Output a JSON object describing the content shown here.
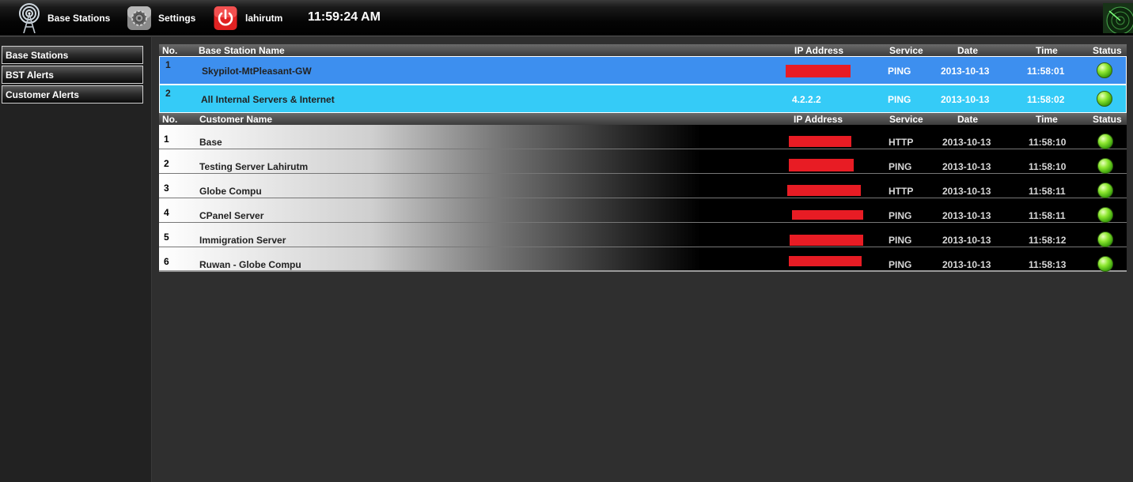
{
  "topbar": {
    "items": [
      {
        "label": "Base Stations",
        "icon": "antenna-icon"
      },
      {
        "label": "Settings",
        "icon": "gear-icon"
      },
      {
        "label": "lahirutm",
        "icon": "power-icon"
      }
    ],
    "clock": "11:59:24 AM",
    "radar_icon": "radar-icon"
  },
  "sidebar": {
    "items": [
      {
        "label": "Base Stations"
      },
      {
        "label": "BST Alerts"
      },
      {
        "label": "Customer Alerts"
      }
    ]
  },
  "base_stations": {
    "headers": {
      "no": "No.",
      "name": "Base Station Name",
      "ip": "IP Address",
      "service": "Service",
      "date": "Date",
      "time": "Time",
      "status": "Status"
    },
    "rows": [
      {
        "no": "1",
        "name": "Skypilot-MtPleasant-GW",
        "ip": "",
        "ip_redacted": true,
        "service": "PING",
        "date": "2013-10-13",
        "time": "11:58:01",
        "status": "up",
        "bg": "#3d8fef"
      },
      {
        "no": "2",
        "name": "All Internal Servers & Internet",
        "ip": "4.2.2.2",
        "ip_redacted": false,
        "service": "PING",
        "date": "2013-10-13",
        "time": "11:58:02",
        "status": "up",
        "bg": "#35cbf7"
      }
    ]
  },
  "customers": {
    "headers": {
      "no": "No.",
      "name": "Customer Name",
      "ip": "IP Address",
      "service": "Service",
      "date": "Date",
      "time": "Time",
      "status": "Status"
    },
    "rows": [
      {
        "no": "1",
        "name": "Base",
        "service": "HTTP",
        "date": "2013-10-13",
        "time": "11:58:10",
        "status": "up"
      },
      {
        "no": "2",
        "name": "Testing Server Lahirutm",
        "service": "PING",
        "date": "2013-10-13",
        "time": "11:58:10",
        "status": "up"
      },
      {
        "no": "3",
        "name": "Globe Compu",
        "service": "HTTP",
        "date": "2013-10-13",
        "time": "11:58:11",
        "status": "up"
      },
      {
        "no": "4",
        "name": "CPanel Server",
        "service": "PING",
        "date": "2013-10-13",
        "time": "11:58:11",
        "status": "up"
      },
      {
        "no": "5",
        "name": "Immigration Server",
        "service": "PING",
        "date": "2013-10-13",
        "time": "11:58:12",
        "status": "up"
      },
      {
        "no": "6",
        "name": "Ruwan - Globe Compu",
        "service": "PING",
        "date": "2013-10-13",
        "time": "11:58:13",
        "status": "up"
      }
    ]
  },
  "colors": {
    "redaction": "#e81c24",
    "status_up": "#8fe832"
  }
}
